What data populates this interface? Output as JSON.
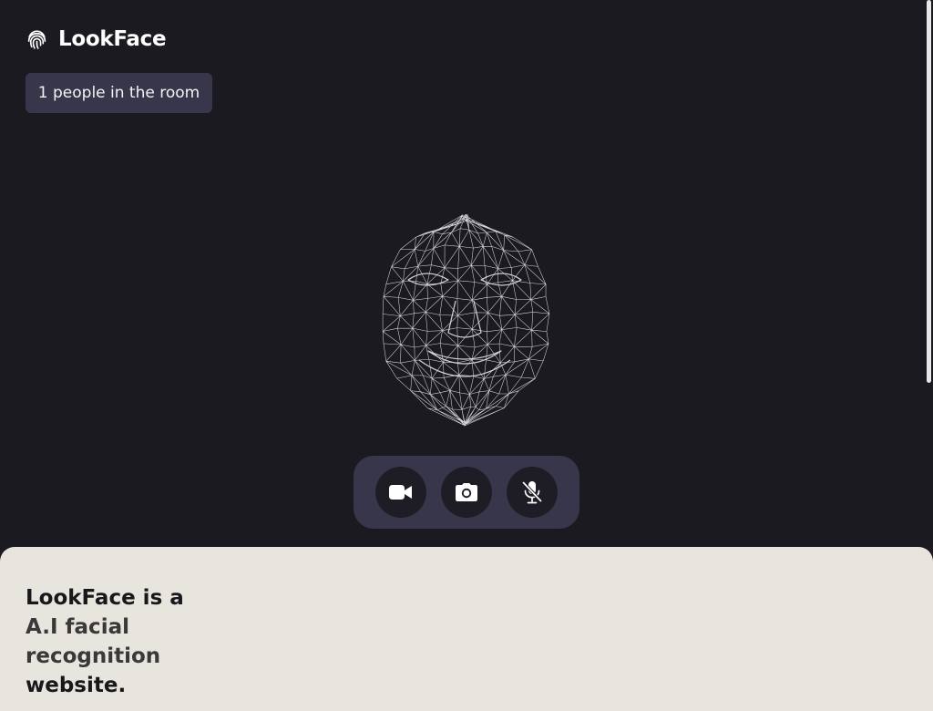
{
  "header": {
    "app_name": "LookFace",
    "logo_icon": "fingerprint-icon"
  },
  "room": {
    "people_label": "1 people in the room"
  },
  "controls": {
    "items": [
      {
        "name": "camera-toggle",
        "icon": "video-camera-icon"
      },
      {
        "name": "snapshot",
        "icon": "camera-icon"
      },
      {
        "name": "microphone-toggle",
        "icon": "microphone-off-icon"
      }
    ]
  },
  "about": {
    "lead": "LookFace is a ",
    "highlight": "A.I facial recognition",
    "tail": " website."
  },
  "colors": {
    "background": "#1b1a21",
    "panel": "#37364a",
    "button": "#1e1d25",
    "about_background": "#e8e4de",
    "text_dark": "#18171c",
    "mesh": "#d8d3da"
  }
}
